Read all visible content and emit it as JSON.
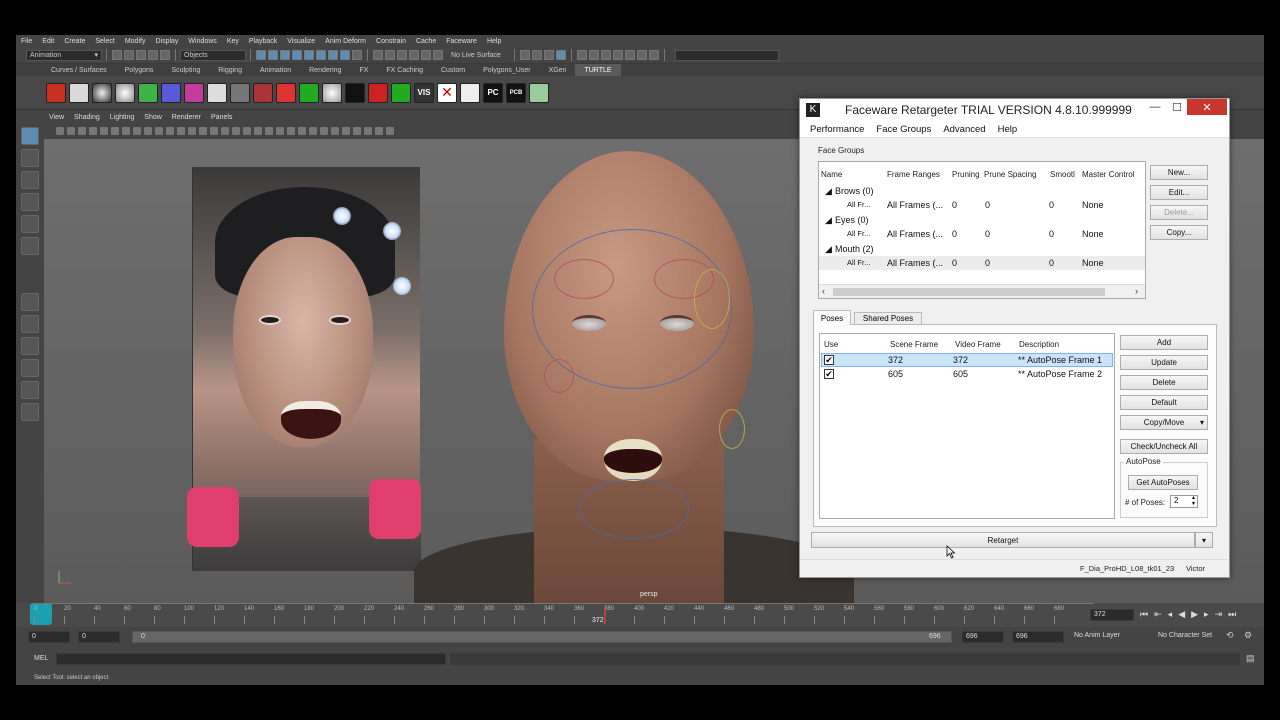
{
  "menubar": [
    "File",
    "Edit",
    "Create",
    "Select",
    "Modify",
    "Display",
    "Windows",
    "Key",
    "Playback",
    "Visualize",
    "Anim Deform",
    "Constrain",
    "Cache",
    "Faceware",
    "Help"
  ],
  "status": {
    "mode": "Animation",
    "objects": "Objects",
    "live_surface": "No Live Surface"
  },
  "shelf_tabs": [
    "Curves / Surfaces",
    "Polygons",
    "Sculpting",
    "Rigging",
    "Animation",
    "Rendering",
    "FX",
    "FX Caching",
    "Custom",
    "Polygons_User",
    "XGen",
    "TURTLE"
  ],
  "shelf_active": "TURTLE",
  "shelf_text_icons": [
    "VIS",
    "PC",
    "PCB"
  ],
  "viewport_menu": [
    "View",
    "Shading",
    "Lighting",
    "Show",
    "Renderer",
    "Panels"
  ],
  "viewport_label": "persp",
  "faceware": {
    "title": "Faceware Retargeter TRIAL VERSION 4.8.10.999999",
    "menu": [
      "Performance",
      "Face Groups",
      "Advanced",
      "Help"
    ],
    "face_groups_label": "Face Groups",
    "fg_headers": [
      "Name",
      "Frame Ranges",
      "Pruning",
      "Prune Spacing",
      "Smootl",
      "Master Control"
    ],
    "fg_rows": [
      {
        "group": "Brows (0)",
        "name": "All Fr...",
        "range": "All Frames (...",
        "pruning": "0",
        "spacing": "0",
        "smooth": "0",
        "master": "None"
      },
      {
        "group": "Eyes (0)",
        "name": "All Fr...",
        "range": "All Frames (...",
        "pruning": "0",
        "spacing": "0",
        "smooth": "0",
        "master": "None"
      },
      {
        "group": "Mouth (2)",
        "name": "All Fr...",
        "range": "All Frames (...",
        "pruning": "0",
        "spacing": "0",
        "smooth": "0",
        "master": "None"
      }
    ],
    "fg_buttons": {
      "new": "New...",
      "edit": "Edit...",
      "delete": "Delete...",
      "copy": "Copy..."
    },
    "tabs": [
      "Poses",
      "Shared Poses"
    ],
    "pose_headers": [
      "Use",
      "Scene Frame",
      "Video Frame",
      "Description"
    ],
    "poses": [
      {
        "checked": "✔",
        "scene": "372",
        "video": "372",
        "desc": "** AutoPose Frame 1"
      },
      {
        "checked": "✔",
        "scene": "605",
        "video": "605",
        "desc": "** AutoPose Frame 2"
      }
    ],
    "pose_buttons": {
      "add": "Add",
      "update": "Update",
      "delete": "Delete",
      "default": "Default",
      "copy_move": "Copy/Move",
      "check": "Check/Uncheck All"
    },
    "autopose": {
      "label": "AutoPose",
      "get": "Get AutoPoses",
      "num_label": "# of Poses:",
      "num": "2"
    },
    "retarget": "Retarget",
    "status_file": "F_Dia_ProHD_L08_tk01_23",
    "status_char": "Victor"
  },
  "timeline": {
    "ticks": [
      "0",
      "20",
      "40",
      "60",
      "80",
      "100",
      "120",
      "140",
      "160",
      "180",
      "200",
      "220",
      "240",
      "260",
      "280",
      "300",
      "320",
      "340",
      "360",
      "380",
      "400",
      "420",
      "440",
      "460",
      "480",
      "500",
      "520",
      "540",
      "560",
      "580",
      "600",
      "620",
      "640",
      "660",
      "680"
    ],
    "current_marker": "372",
    "current_frame": "372"
  },
  "range": {
    "start": "0",
    "anim_start": "0",
    "slider_start": "0",
    "slider_end": "696",
    "end": "696",
    "anim_end": "696",
    "anim_layer": "No Anim Layer",
    "character_set": "No Character Set"
  },
  "mel_label": "MEL",
  "help_text": "Select Tool: select an object",
  "colors": {
    "maya_bg": "#444444",
    "highlight": "#5e8db3",
    "fw_selected": "#cce4f7",
    "fw_close": "#c8372f"
  }
}
